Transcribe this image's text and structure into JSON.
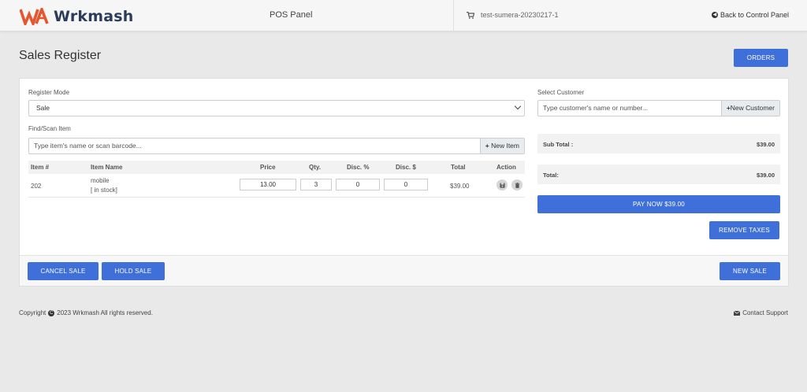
{
  "header": {
    "brand": "Wrkmash",
    "panel_title": "POS Panel",
    "store_name": "test-sumera-20230217-1",
    "back_link": "Back to Control Panel",
    "brand_colors": {
      "logo_orange": "#e4572e",
      "logo_navy": "#2b3c5a"
    }
  },
  "page": {
    "title": "Sales Register",
    "orders_label": "ORDERS"
  },
  "register": {
    "mode_label": "Register Mode",
    "mode_value": "Sale",
    "find_label": "Find/Scan Item",
    "find_placeholder": "Type item's name or scan barcode...",
    "new_item_label": "New Item"
  },
  "customer": {
    "label": "Select Customer",
    "placeholder": "Type customer's name or number...",
    "new_customer_label": "New Customer"
  },
  "table": {
    "headers": [
      "Item #",
      "Item Name",
      "Price",
      "Qty.",
      "Disc. %",
      "Disc. $",
      "Total",
      "Action"
    ],
    "rows": [
      {
        "item_no": "202",
        "name": "mobile",
        "stock": "[ in stock]",
        "price": "13.00",
        "qty": "3",
        "disc_pct": "0",
        "disc_amt": "0",
        "total": "$39.00"
      }
    ]
  },
  "summary": {
    "subtotal_label": "Sub Total :",
    "subtotal_value": "$39.00",
    "total_label": "Total:",
    "total_value": "$39.00"
  },
  "actions": {
    "pay_now": "PAY NOW $39.00",
    "remove_taxes": "REMOVE TAXES",
    "cancel_sale": "CANCEL SALE",
    "hold_sale": "HOLD SALE",
    "new_sale": "NEW SALE"
  },
  "footer": {
    "copyright_prefix": "Copyright",
    "copyright_text": "2023 Wrkmash All rights reserved.",
    "contact": "Contact Support"
  },
  "colors": {
    "primary_button": "#3f6fd9"
  }
}
